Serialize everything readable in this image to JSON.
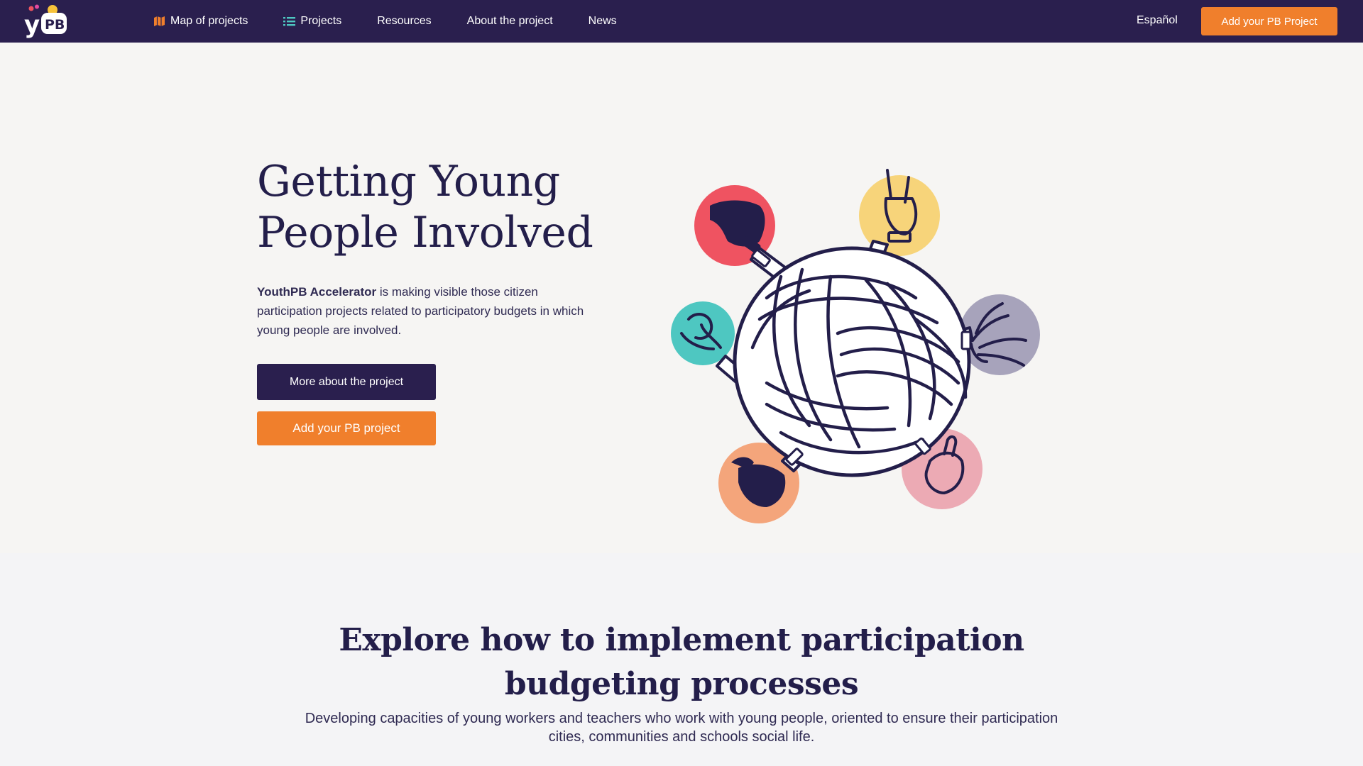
{
  "header": {
    "logo_text": "yPB",
    "nav": [
      {
        "label": "Map of projects",
        "icon": "map-icon"
      },
      {
        "label": "Projects",
        "icon": "list-icon"
      },
      {
        "label": "Resources"
      },
      {
        "label": "About the project"
      },
      {
        "label": "News"
      }
    ],
    "language": "Español",
    "cta_label": "Add your PB Project"
  },
  "hero": {
    "title": "Getting Young People Involved",
    "desc_strong": "YouthPB Accelerator",
    "desc_rest": " is making visible those citizen participation projects related to participatory budgets in which young people are involved.",
    "more_button": "More about the project",
    "add_button": "Add your PB project"
  },
  "explore": {
    "title": "Explore how to implement participation budgeting processes",
    "subtitle": "Developing capacities of young workers and teachers who work with young people, oriented to ensure their participation cities, communities and schools social life."
  },
  "colors": {
    "nav_bg": "#2a1f4e",
    "accent_orange": "#f07f2c",
    "text_dark": "#231e4a",
    "circle_red": "#ef5361",
    "circle_yellow": "#f7d47a",
    "circle_teal": "#4ec7c1",
    "circle_gray": "#a7a3bb",
    "circle_orange": "#f4a57b",
    "circle_pink": "#ecaab4"
  }
}
